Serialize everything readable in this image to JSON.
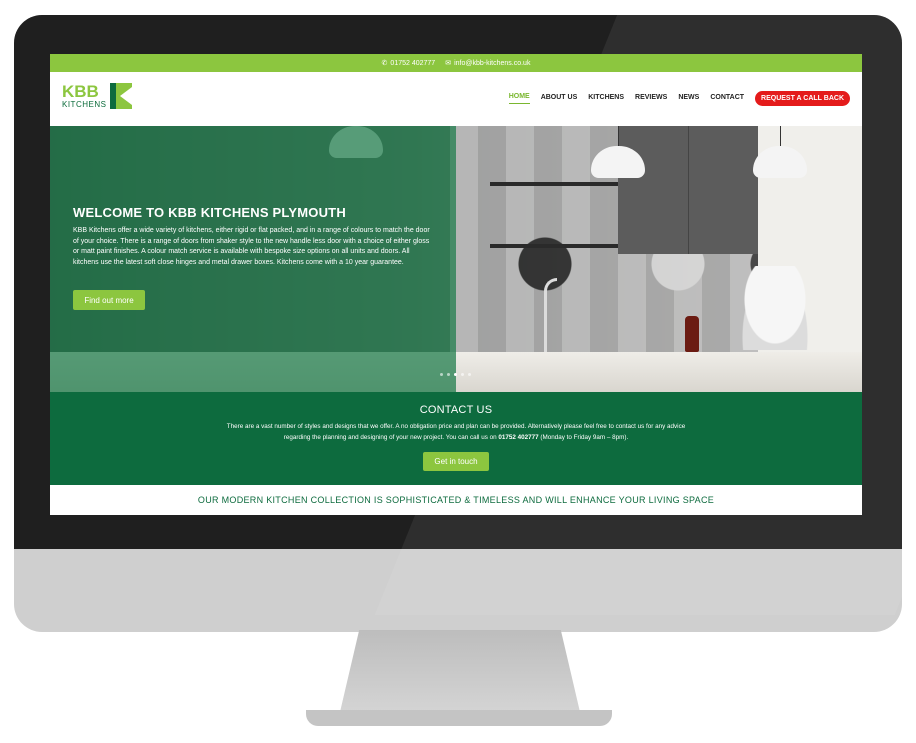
{
  "topbar": {
    "phone": "01752 402777",
    "email": "info@kbb-kitchens.co.uk",
    "phone_icon": "phone-icon",
    "email_icon": "envelope-icon"
  },
  "logo": {
    "brand": "KBB",
    "sub": "KITCHENS"
  },
  "nav": {
    "items": [
      {
        "label": "HOME"
      },
      {
        "label": "ABOUT US"
      },
      {
        "label": "KITCHENS"
      },
      {
        "label": "REVIEWS"
      },
      {
        "label": "NEWS"
      },
      {
        "label": "CONTACT"
      }
    ],
    "cta": "REQUEST A CALL BACK"
  },
  "hero": {
    "title": "WELCOME TO KBB KITCHENS PLYMOUTH",
    "body": "KBB Kitchens offer a wide variety of kitchens, either rigid or flat packed, and in a range of colours to match the door of your choice. There is a range of doors from shaker style to the new handle less door with a choice of either gloss or matt paint finishes. A colour match service is available with bespoke size options on all units and doors. All kitchens use the latest soft close hinges and metal drawer boxes. Kitchens come with a 10 year guarantee.",
    "button": "Find out more"
  },
  "contact": {
    "title": "CONTACT US",
    "body_before": "There are a vast number of styles and designs that we offer. A no obligation price and plan can be provided. Alternatively please feel free to contact us for any advice regarding the planning and designing of your new project. You can call us on ",
    "phone": "01752 402777",
    "body_after": " (Monday to Friday 9am – 8pm).",
    "button": "Get in touch"
  },
  "collection": {
    "text": "OUR MODERN KITCHEN COLLECTION IS SOPHISTICATED & TIMELESS AND WILL ENHANCE YOUR LIVING SPACE"
  },
  "colors": {
    "brand_green": "#8cc63f",
    "dark_green": "#0d6b3e",
    "cta_red": "#e41b1b"
  }
}
